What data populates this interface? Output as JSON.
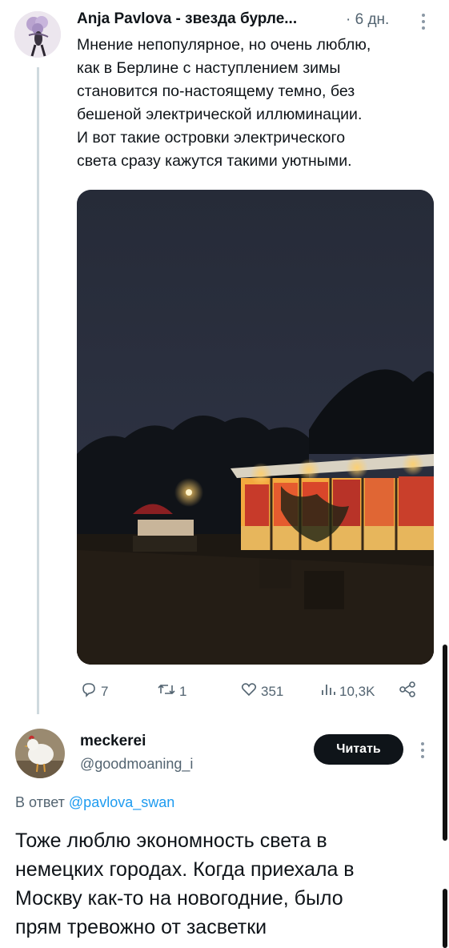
{
  "tweet": {
    "author_name": "Anja Pavlova - звезда бурле...",
    "age": "· 6 дн.",
    "text_lines": [
      "Мнение непопулярное, но очень люблю,",
      "как в Берлине с наступлением зимы",
      "становится по-настоящему темно, без",
      "бешеной электрической иллюминации.",
      "И вот такие островки электрического",
      "света сразу кажутся такими уютными."
    ],
    "replies": "7",
    "reposts": "1",
    "likes": "351",
    "views": "10,3K"
  },
  "reply": {
    "author_name": "meckerei",
    "handle": "@goodmoaning_i",
    "follow_label": "Читать",
    "reply_prefix": "В ответ",
    "reply_to": "@pavlova_swan",
    "text_lines": [
      "Тоже люблю экономность света в",
      "немецких городах. Когда приехала в",
      "Москву как-то на новогодние, было",
      "прям тревожно от засветки"
    ]
  },
  "icons": [
    "reply-icon",
    "repost-icon",
    "like-icon",
    "views-icon",
    "share-icon",
    "more-icon"
  ],
  "colors": {
    "accent": "#1d9bf0",
    "text": "#0f1419",
    "muted": "#536471",
    "follow_bg": "#0f1419"
  }
}
